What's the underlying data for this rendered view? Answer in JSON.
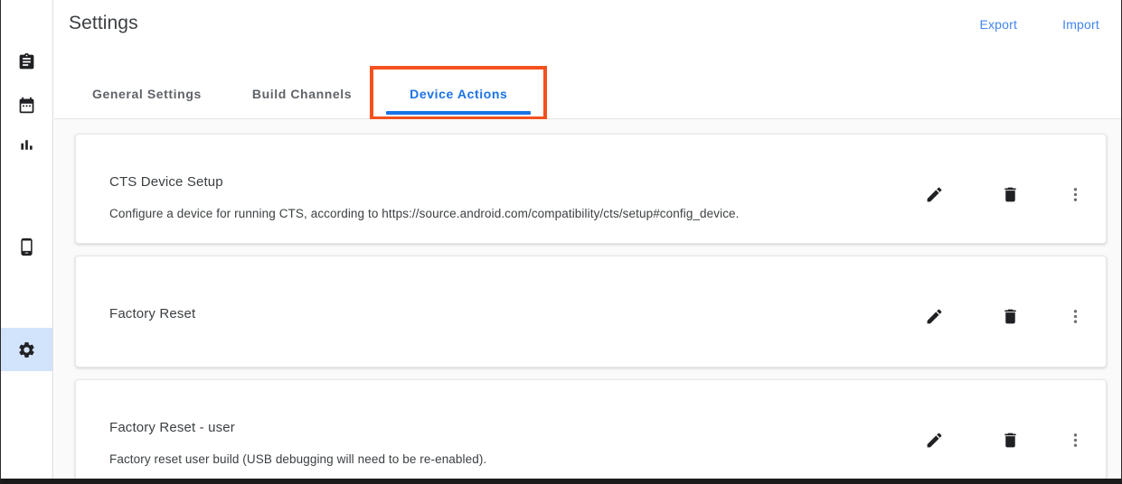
{
  "app": {
    "title": "Settings"
  },
  "sidebar": {
    "items": [
      {
        "name": "assignment-icon",
        "label": "Results",
        "active": false
      },
      {
        "name": "calendar-icon",
        "label": "Schedules",
        "active": false
      },
      {
        "name": "bar-chart-icon",
        "label": "Analytics",
        "active": false
      },
      {
        "name": "phone-android-icon",
        "label": "Devices",
        "active": false
      },
      {
        "name": "gear-icon",
        "label": "Settings",
        "active": true
      }
    ]
  },
  "header": {
    "title": "Settings",
    "export_label": "Export",
    "import_label": "Import"
  },
  "tabs": [
    {
      "label": "General Settings",
      "active": false,
      "highlighted": false
    },
    {
      "label": "Build Channels",
      "active": false,
      "highlighted": false
    },
    {
      "label": "Device Actions",
      "active": true,
      "highlighted": true
    }
  ],
  "device_actions": [
    {
      "title": "CTS Device Setup",
      "description": "Configure a device for running CTS, according to https://source.android.com/compatibility/cts/setup#config_device."
    },
    {
      "title": "Factory Reset",
      "description": ""
    },
    {
      "title": "Factory Reset - user",
      "description": "Factory reset user build (USB debugging will need to be re-enabled)."
    }
  ],
  "row_actions": {
    "edit_label": "Edit",
    "delete_label": "Delete",
    "more_label": "More options"
  },
  "colors": {
    "accent_blue": "#1a73e8",
    "link_blue": "#4285f4",
    "highlight_orange": "#f4511e",
    "rail_active_bg": "#d2e3fc",
    "content_bg": "#fafafa",
    "text_primary": "#3c4043",
    "text_secondary": "#5f6368",
    "icon_gray": "#6e6e6e"
  }
}
